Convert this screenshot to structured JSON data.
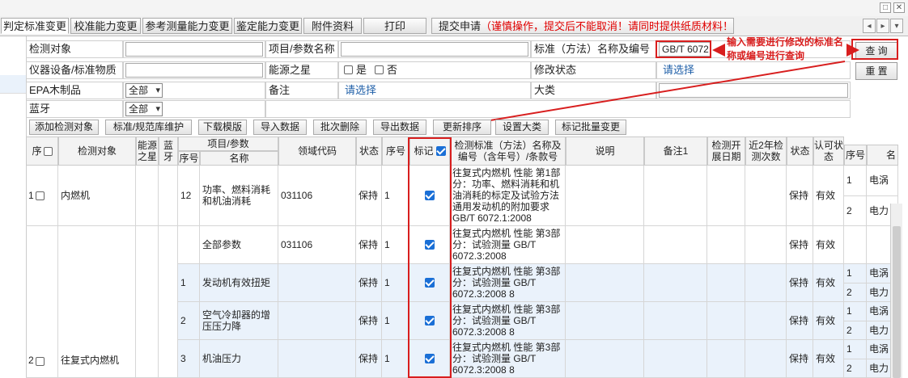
{
  "window": {
    "minimize": "□",
    "close": "✕"
  },
  "tabs": [
    "判定标准变更",
    "校准能力变更",
    "参考测量能力变更",
    "鉴定能力变更",
    "附件资料",
    "打印"
  ],
  "submit_tab": {
    "label": "提交申请",
    "warning": "（谨慎操作，提交后不能取消！请同时提供纸质材料！）"
  },
  "nav": {
    "prev": "◂",
    "next": "▸",
    "menu": "▾"
  },
  "form": {
    "detect_object_label": "检测对象",
    "item_param_label": "项目/参数名称",
    "standard_label": "标准（方法）名称及编号",
    "standard_value": "GB/T 6072",
    "instrument_label": "仪器设备/标准物质",
    "energy_star_label": "能源之星",
    "energy_yes": "是",
    "energy_no": "否",
    "modify_status_label": "修改状态",
    "modify_status_value": "请选择",
    "epa_label": "EPA木制品",
    "epa_value": "全部",
    "remark_label": "备注",
    "remark_value": "请选择",
    "category_label": "大类",
    "bluetooth_label": "蓝牙",
    "bluetooth_value": "全部",
    "query_btn": "查 询",
    "reset_btn": "重 置"
  },
  "annotation": "输入需要进行修改的标准名称或编号进行查询",
  "toolbar": [
    "添加检测对象",
    "标准/规范库维护",
    "下载模版",
    "导入数据",
    "批次删除",
    "导出数据",
    "更新排序",
    "设置大类",
    "标记批量变更"
  ],
  "headers": {
    "seq": "序",
    "detect_object": "检测对象",
    "energy_star": "能源之星",
    "bluetooth": "蓝牙",
    "item_param": "项目/参数",
    "item_no": "序号",
    "item_name": "名称",
    "domain_code": "领域代码",
    "status": "状态",
    "order": "序号",
    "mark": "标记",
    "standard": "检测标准（方法）名称及编号（含年号）/条款号",
    "desc": "说明",
    "remark1": "备注1",
    "start_date": "检测开展日期",
    "recent2y": "近2年检测次数",
    "status2": "状态",
    "approval": "认可状态",
    "sub_no": "序号",
    "sub_name": "名"
  },
  "rows": [
    {
      "seq": "1",
      "object": "内燃机",
      "item_no": "12",
      "item_name": "功率、燃料消耗和机油消耗",
      "code": "031106",
      "status": "保持",
      "order": "1",
      "standard": "往复式内燃机 性能 第1部分：功率、燃料消耗和机油消耗的标定及试验方法 通用发动机的附加要求 GB/T 6072.1:2008",
      "status2": "保持",
      "approval": "有效",
      "sub": [
        {
          "no": "1",
          "name": "电涡"
        },
        {
          "no": "2",
          "name": "电力"
        }
      ]
    },
    {
      "seq": "",
      "object": "",
      "item_no": "",
      "item_name": "全部参数",
      "code": "031106",
      "status": "保持",
      "order": "1",
      "standard": "往复式内燃机 性能 第3部分：试验测量 GB/T 6072.3:2008",
      "status2": "保持",
      "approval": "有效",
      "sub": []
    },
    {
      "seq": "",
      "object": "",
      "item_no": "1",
      "item_name": "发动机有效扭矩",
      "code": "",
      "status": "保持",
      "order": "1",
      "standard": "往复式内燃机 性能 第3部分：试验测量 GB/T 6072.3:2008 8",
      "status2": "保持",
      "approval": "有效",
      "sub": [
        {
          "no": "1",
          "name": "电涡"
        },
        {
          "no": "2",
          "name": "电力"
        }
      ]
    },
    {
      "seq": "",
      "object": "",
      "item_no": "2",
      "item_name": "空气冷却器的增压压力降",
      "code": "",
      "status": "保持",
      "order": "1",
      "standard": "往复式内燃机 性能 第3部分：试验测量 GB/T 6072.3:2008 8",
      "status2": "保持",
      "approval": "有效",
      "sub": [
        {
          "no": "1",
          "name": "电涡"
        },
        {
          "no": "2",
          "name": "电力"
        }
      ]
    },
    {
      "seq": "2",
      "object": "往复式内燃机",
      "item_no": "3",
      "item_name": "机油压力",
      "code": "",
      "status": "保持",
      "order": "1",
      "standard": "往复式内燃机 性能 第3部分：试验测量 GB/T 6072.3:2008 8",
      "status2": "保持",
      "approval": "有效",
      "sub": [
        {
          "no": "1",
          "name": "电涡"
        },
        {
          "no": "2",
          "name": "电力"
        }
      ]
    }
  ],
  "colors": {
    "accent_red": "#d81e1e",
    "checkbox_blue": "#1a6fd6",
    "row_alt": "#eaf2fb"
  }
}
